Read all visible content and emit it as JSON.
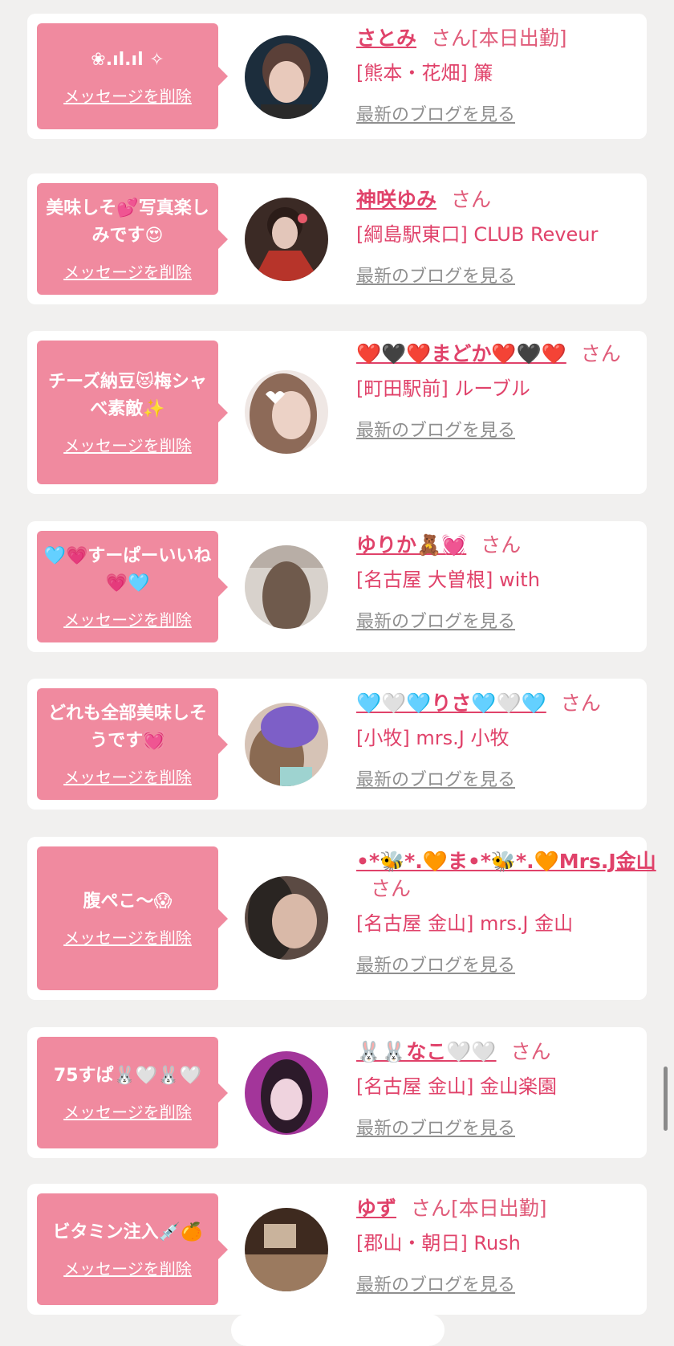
{
  "messages": [
    {
      "message": "❀.ıl.ıl ✧",
      "delete_label": "メッセージを削除",
      "name": "さとみ",
      "suffix": "さん[本日出勤]",
      "shop": "[熊本・花畑] 簾",
      "blog_label": "最新のブログを見る",
      "avatar_colors": [
        "#1c2d3c",
        "#5b4038",
        "#d9b8a9"
      ]
    },
    {
      "message": "美味しそ💕写真楽しみです😍",
      "delete_label": "メッセージを削除",
      "name": "神咲ゆみ",
      "suffix": "さん",
      "shop": "[綱島駅東口] CLUB Reveur",
      "blog_label": "最新のブログを見る",
      "avatar_colors": [
        "#7b3328",
        "#c8a59b",
        "#3b2a25"
      ]
    },
    {
      "message": "チーズ納豆😻梅シャべ素敵✨",
      "delete_label": "メッセージを削除",
      "name": "❤️🖤❤️まどか❤️🖤❤️",
      "suffix": "さん",
      "shop": "[町田駅前] ルーブル",
      "blog_label": "最新のブログを見る",
      "avatar_colors": [
        "#8d6a58",
        "#e8d7d2",
        "#6d4d3c"
      ]
    },
    {
      "message": "🩵💗すーぱーいいね💗🩵",
      "delete_label": "メッセージを削除",
      "name": "ゆりか🧸💓",
      "suffix": "さん",
      "shop": "[名古屋 大曽根] with",
      "blog_label": "最新のブログを見る",
      "avatar_colors": [
        "#b8aea6",
        "#6f5a4c",
        "#d8d2cc"
      ]
    },
    {
      "message": "どれも全部美味しそうです💓",
      "delete_label": "メッセージを削除",
      "name": "🩵🤍🩵りさ🩵🤍🩵",
      "suffix": "さん",
      "shop": "[小牧] mrs.J 小牧",
      "blog_label": "最新のブログを見る",
      "avatar_colors": [
        "#7d5fc7",
        "#8a6a52",
        "#d6c3b6"
      ]
    },
    {
      "message": "腹ぺこ〜😱",
      "delete_label": "メッセージを削除",
      "name": "•*🐝*.🧡ま•*🐝*.🧡Mrs.J金山",
      "suffix": "さん",
      "shop": "[名古屋 金山] mrs.J 金山",
      "blog_label": "最新のブログを見る",
      "avatar_colors": [
        "#2a2522",
        "#c9ab9a",
        "#5b4a43"
      ]
    },
    {
      "message": "75すぱ🐰🤍🐰🤍",
      "delete_label": "メッセージを削除",
      "name": "🐰🐰なこ🤍🤍",
      "suffix": "さん",
      "shop": "[名古屋 金山] 金山楽園",
      "blog_label": "最新のブログを見る",
      "avatar_colors": [
        "#a3359a",
        "#e7c5d4",
        "#2c1a2a"
      ]
    },
    {
      "message": "ビタミン注入💉🍊",
      "delete_label": "メッセージを削除",
      "name": "ゆず",
      "suffix": "さん[本日出勤]",
      "shop": "[郡山・朝日] Rush",
      "blog_label": "最新のブログを見る",
      "avatar_colors": [
        "#3e2a1f",
        "#9b7a5f",
        "#c9b39c"
      ]
    }
  ]
}
